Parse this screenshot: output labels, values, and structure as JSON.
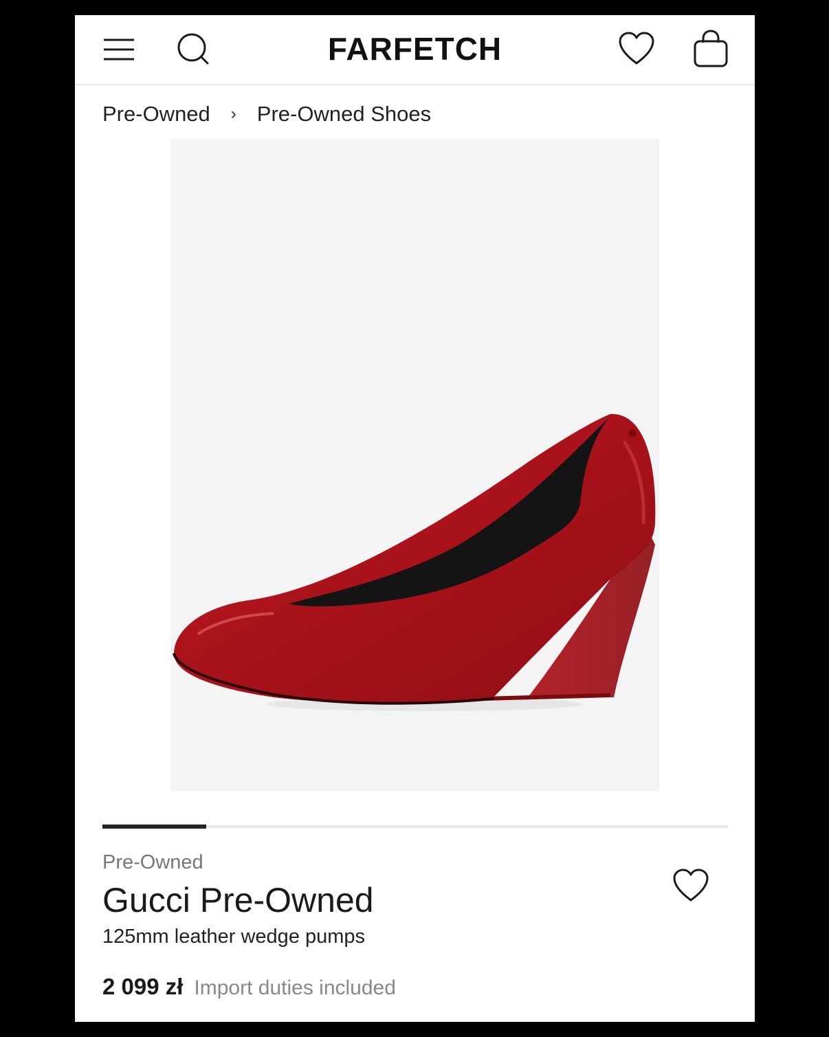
{
  "header": {
    "logo": "FARFETCH",
    "icons": [
      "menu-icon",
      "search-icon",
      "heart-icon",
      "bag-icon"
    ]
  },
  "breadcrumb": {
    "items": [
      "Pre-Owned",
      "Pre-Owned Shoes"
    ],
    "separator": "›"
  },
  "gallery": {
    "image_alt": "red patent leather wedge pump",
    "progress": 0.166
  },
  "product": {
    "condition": "Pre-Owned",
    "brand": "Gucci Pre-Owned",
    "description": "125mm leather wedge pumps",
    "price": "2 099 zł",
    "duties_note": "Import duties included"
  },
  "colors": {
    "shoe": "#a8121a",
    "background": "#f4f4f4",
    "text": "#1a1a1a",
    "muted": "#888888"
  }
}
